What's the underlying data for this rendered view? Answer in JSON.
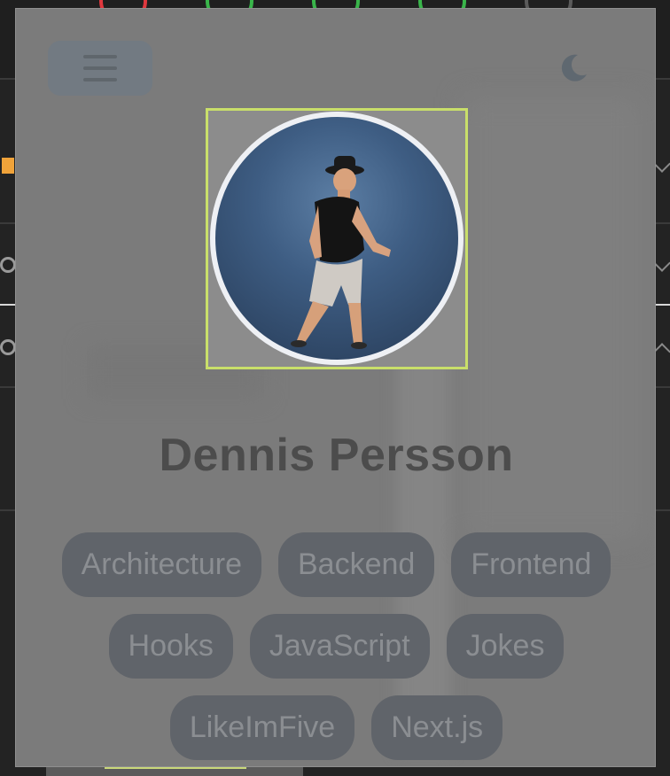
{
  "header": {
    "menu_icon": "hamburger-menu-icon",
    "theme_icon": "moon-icon"
  },
  "profile": {
    "name": "Dennis Persson",
    "avatar_icon": "profile-photo"
  },
  "tags": [
    "Architecture",
    "Backend",
    "Frontend",
    "Hooks",
    "JavaScript",
    "Jokes",
    "LikeImFive",
    "Next.js"
  ],
  "colors": {
    "overlay": "#7b7b7b",
    "avatar_border": "#c9df6a",
    "tag_bg": "#60646a",
    "tag_text": "#8b8e92",
    "name_text": "#4c4c4c",
    "status_green": "#39b54a",
    "status_red": "#e0383e",
    "accent_orange": "#f0a33a"
  }
}
